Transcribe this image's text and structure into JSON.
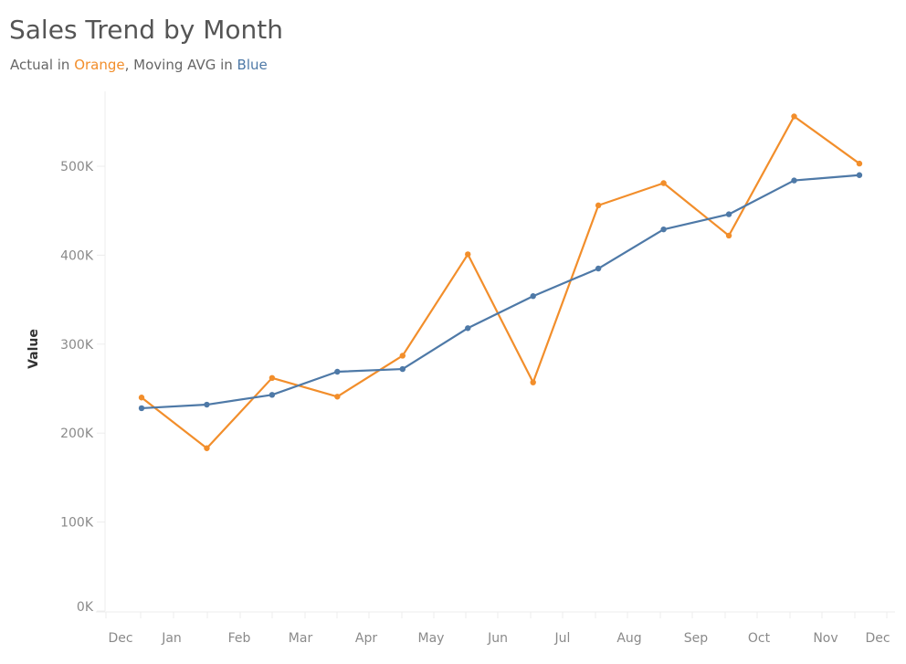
{
  "chart_data": {
    "type": "line",
    "title": "Sales Trend by Month",
    "subtitle": {
      "prefix": "Actual in ",
      "orange_word": "Orange",
      "middle": ", Moving AVG in ",
      "blue_word": "Blue"
    },
    "xlabel": "",
    "ylabel": "Value",
    "ylim": [
      0,
      570000
    ],
    "y_ticks": [
      0,
      100000,
      200000,
      300000,
      400000,
      500000
    ],
    "y_tick_labels": [
      "0K",
      "100K",
      "200K",
      "300K",
      "400K",
      "500K"
    ],
    "x_tick_labels": [
      "Dec",
      "Jan",
      "Feb",
      "Mar",
      "Apr",
      "May",
      "Jun",
      "Jul",
      "Aug",
      "Sep",
      "Oct",
      "Nov",
      "Dec"
    ],
    "categories": [
      "Jan",
      "Feb",
      "Mar",
      "Apr",
      "May",
      "Jun",
      "Jul",
      "Aug",
      "Sep",
      "Oct",
      "Nov",
      "Dec"
    ],
    "grid": false,
    "legend": "none",
    "series": [
      {
        "name": "Actual",
        "color": "#F28E2B",
        "values": [
          240000,
          183000,
          262000,
          241000,
          287000,
          401000,
          257000,
          456000,
          481000,
          422000,
          556000,
          503000
        ]
      },
      {
        "name": "Moving AVG",
        "color": "#4E79A7",
        "values": [
          228000,
          232000,
          243000,
          269000,
          272000,
          318000,
          354000,
          385000,
          429000,
          446000,
          484000,
          490000
        ]
      }
    ]
  }
}
